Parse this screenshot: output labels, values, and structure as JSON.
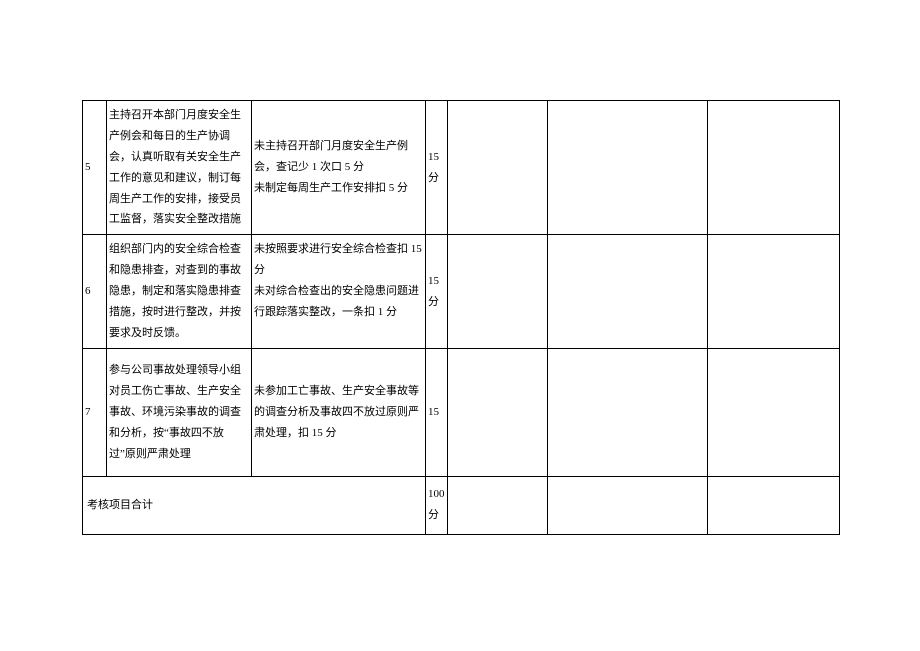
{
  "rows": [
    {
      "num": "5",
      "content": "主持召开本部门月度安全生产例会和每日的生产协调会，认真听取有关安全生产工作的意见和建议，制订每周生产工作的安排，接受员工监督，落实安全整改措施",
      "criteria": "未主持召开部门月度安全生产例会，查记少 1 次口 5 分\n未制定每周生产工作安排扣 5 分",
      "score": "15分"
    },
    {
      "num": "6",
      "content": "组织部门内的安全综合检查和隐患排查，对查到的事故隐患，制定和落实隐患排查措施，按时进行整改，并按要求及时反馈。",
      "criteria": "未按照要求进行安全综合检查扣 15 分\n未对综合检查出的安全隐患问题进行跟踪落实整改，一条扣 1 分",
      "score": "15分"
    },
    {
      "num": "7",
      "content": "参与公司事故处理领导小组对员工伤亡事故、生产安全事故、环境污染事故的调查和分析，按“事故四不放过”原则严肃处理",
      "criteria": "未参加工亡事故、生产安全事故等的调查分析及事故四不放过原则严肃处理，扣 15 分",
      "score": "15"
    }
  ],
  "total": {
    "label": "考核项目合计",
    "score": "100 分"
  }
}
